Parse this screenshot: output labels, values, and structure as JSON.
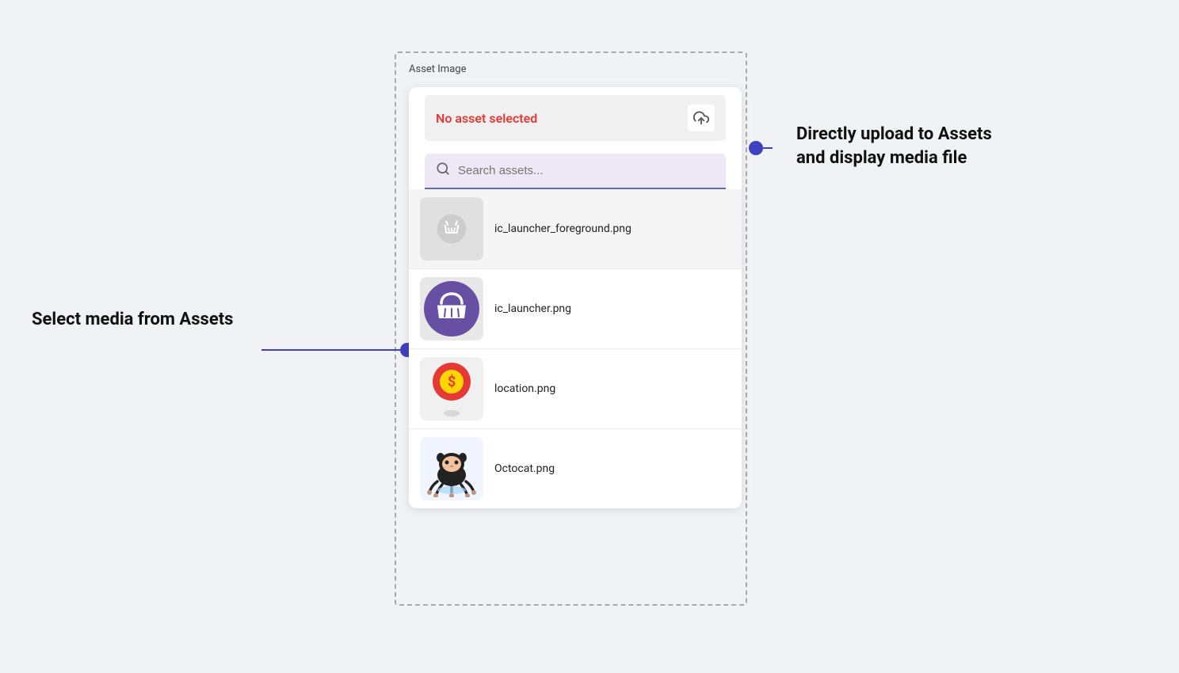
{
  "panel": {
    "label": "Asset Image"
  },
  "no_asset": {
    "text": "No asset selected"
  },
  "search": {
    "placeholder": "Search assets..."
  },
  "assets": [
    {
      "id": "foreground",
      "name": "ic_launcher_foreground.png",
      "type": "placeholder"
    },
    {
      "id": "launcher",
      "name": "ic_launcher.png",
      "type": "basket"
    },
    {
      "id": "location",
      "name": "location.png",
      "type": "location"
    },
    {
      "id": "octocat",
      "name": "Octocat.png",
      "type": "octocat"
    }
  ],
  "annotations": {
    "left_label": "Select media from Assets",
    "right_label": "Directly upload to Assets\nand display media file"
  },
  "colors": {
    "accent": "#4040c0",
    "error": "#e53935",
    "search_bg": "#ede7f6",
    "search_border": "#5c6bc0"
  }
}
